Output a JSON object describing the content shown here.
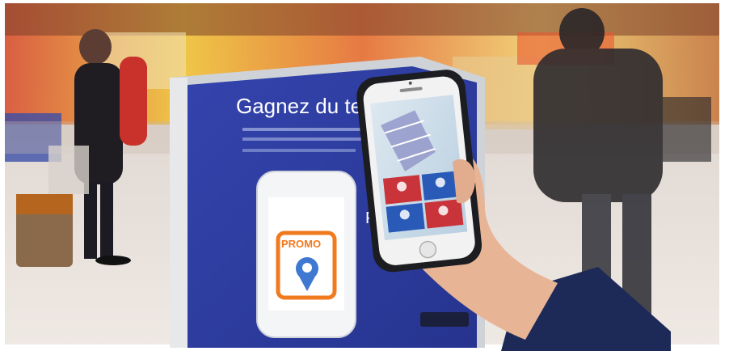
{
  "photo": {
    "poster_headline": "Gagnez du tem",
    "app_badge_text": "PROMO",
    "poster_small_label": "P"
  },
  "colors": {
    "poster_blue": "#2f3fa4",
    "app_tile_red": "#c9343a",
    "app_tile_blue": "#2a5ab8",
    "badge_orange": "#f07a1e",
    "sleeve_navy": "#1d2a58"
  },
  "icons": {
    "map_pin": "map-pin-icon",
    "home_button": "home-button-icon"
  }
}
